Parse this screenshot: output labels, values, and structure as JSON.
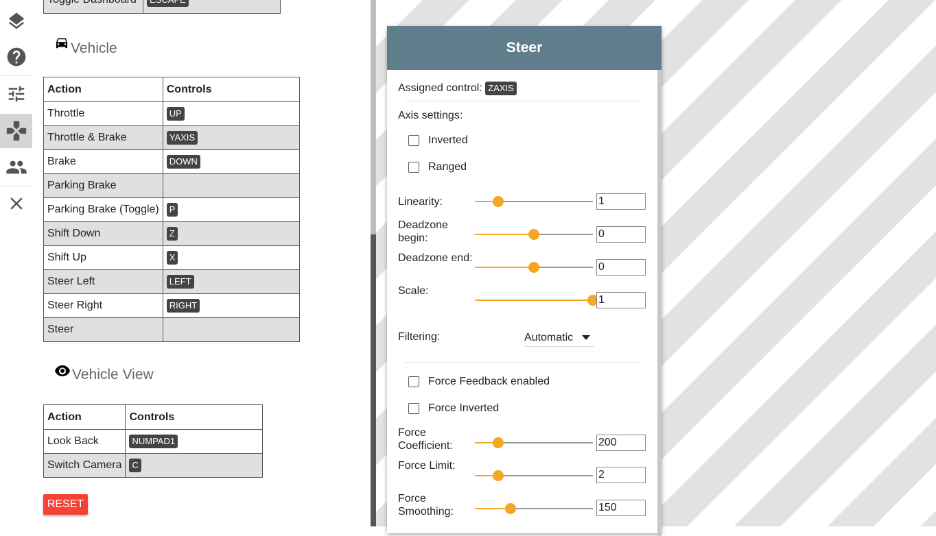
{
  "rail": {
    "items": [
      {
        "name": "layers-icon"
      },
      {
        "name": "help-icon"
      },
      {
        "name": "sliders-icon"
      },
      {
        "name": "gamepad-icon",
        "active": true
      },
      {
        "name": "people-icon"
      },
      {
        "name": "close-icon"
      }
    ]
  },
  "top_table": {
    "row": {
      "action": "Toggle Dashboard",
      "key": "ESCAPE"
    }
  },
  "vehicle": {
    "title": "Vehicle",
    "headers": {
      "action": "Action",
      "controls": "Controls"
    },
    "rows": [
      {
        "action": "Throttle",
        "key": "UP"
      },
      {
        "action": "Throttle & Brake",
        "key": "YAXIS"
      },
      {
        "action": "Brake",
        "key": "DOWN"
      },
      {
        "action": "Parking Brake",
        "key": ""
      },
      {
        "action": "Parking Brake (Toggle)",
        "key": "P"
      },
      {
        "action": "Shift Down",
        "key": "Z"
      },
      {
        "action": "Shift Up",
        "key": "X"
      },
      {
        "action": "Steer Left",
        "key": "LEFT"
      },
      {
        "action": "Steer Right",
        "key": "RIGHT"
      },
      {
        "action": "Steer",
        "key": ""
      }
    ]
  },
  "vehicle_view": {
    "title": "Vehicle View",
    "headers": {
      "action": "Action",
      "controls": "Controls"
    },
    "rows": [
      {
        "action": "Look Back",
        "key": "NUMPAD1"
      },
      {
        "action": "Switch Camera",
        "key": "C"
      }
    ]
  },
  "reset_label": "RESET",
  "steer": {
    "title": "Steer",
    "assigned_label": "Assigned control:",
    "assigned_key": "ZAXIS",
    "axis_settings_label": "Axis settings:",
    "inverted_label": "Inverted",
    "inverted_checked": false,
    "ranged_label": "Ranged",
    "ranged_checked": false,
    "linearity_label": "Linearity:",
    "linearity_value": "1",
    "deadzone_begin_label_1": "Deadzone",
    "deadzone_begin_label_2": "begin:",
    "deadzone_begin_value": "0",
    "deadzone_end_label": "Deadzone end:",
    "deadzone_end_value": "0",
    "scale_label": "Scale:",
    "scale_value": "1",
    "filtering_label": "Filtering:",
    "filtering_value": "Automatic",
    "ff_enabled_label": "Force Feedback enabled",
    "ff_enabled_checked": false,
    "force_inverted_label": "Force Inverted",
    "force_inverted_checked": false,
    "force_coef_label_1": "Force",
    "force_coef_label_2": "Coefficient:",
    "force_coef_value": "200",
    "force_limit_label": "Force Limit:",
    "force_limit_value": "2",
    "force_smoothing_label_1": "Force",
    "force_smoothing_label_2": "Smoothing:",
    "force_smoothing_value": "150",
    "slider_levels": {
      "linearity": 0.2,
      "deadzone_begin": 0.5,
      "deadzone_end": 0.5,
      "scale": 1.0,
      "force_coef": 0.2,
      "force_limit": 0.2,
      "force_smoothing": 0.3
    },
    "accent_color": "#f5a623",
    "header_color": "#607d8b"
  },
  "colors": {
    "reset": "#f44336",
    "key_badge": "#444444"
  }
}
